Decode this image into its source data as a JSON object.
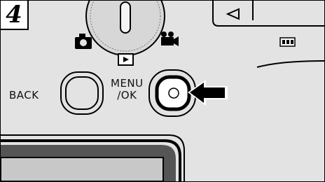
{
  "step": {
    "number": "4"
  },
  "buttons": {
    "back_label": "BACK",
    "menu_line1": "MENU",
    "menu_line2": "/OK"
  },
  "icons": [
    "camera-icon",
    "movie-camera-icon",
    "playback-icon",
    "battery-icon",
    "arrow-icon"
  ],
  "colors": {
    "body": "#e3e3e3",
    "outline": "#000000"
  }
}
